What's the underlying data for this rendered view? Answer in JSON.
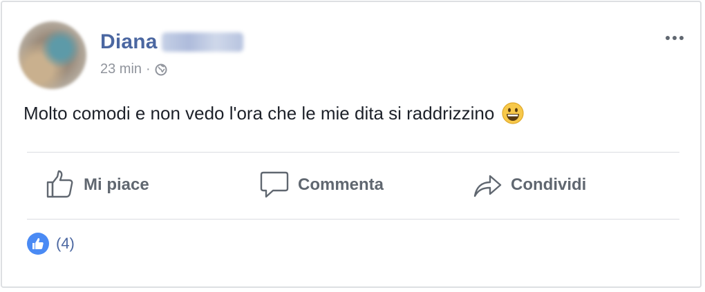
{
  "post": {
    "author_first_name": "Diana",
    "timestamp": "23 min",
    "separator": "·",
    "privacy_icon": "globe-icon",
    "text": "Molto comodi e non vedo l'ora che le mie dita si raddrizzino",
    "emoji": "grinning-face-emoji"
  },
  "actions": {
    "like_label": "Mi piace",
    "comment_label": "Commenta",
    "share_label": "Condividi"
  },
  "reactions": {
    "count_text": "(4)"
  },
  "colors": {
    "name": "#4b67a1",
    "action_text": "#606770",
    "like_badge": "#4a8af4",
    "divider": "#dadde1"
  }
}
